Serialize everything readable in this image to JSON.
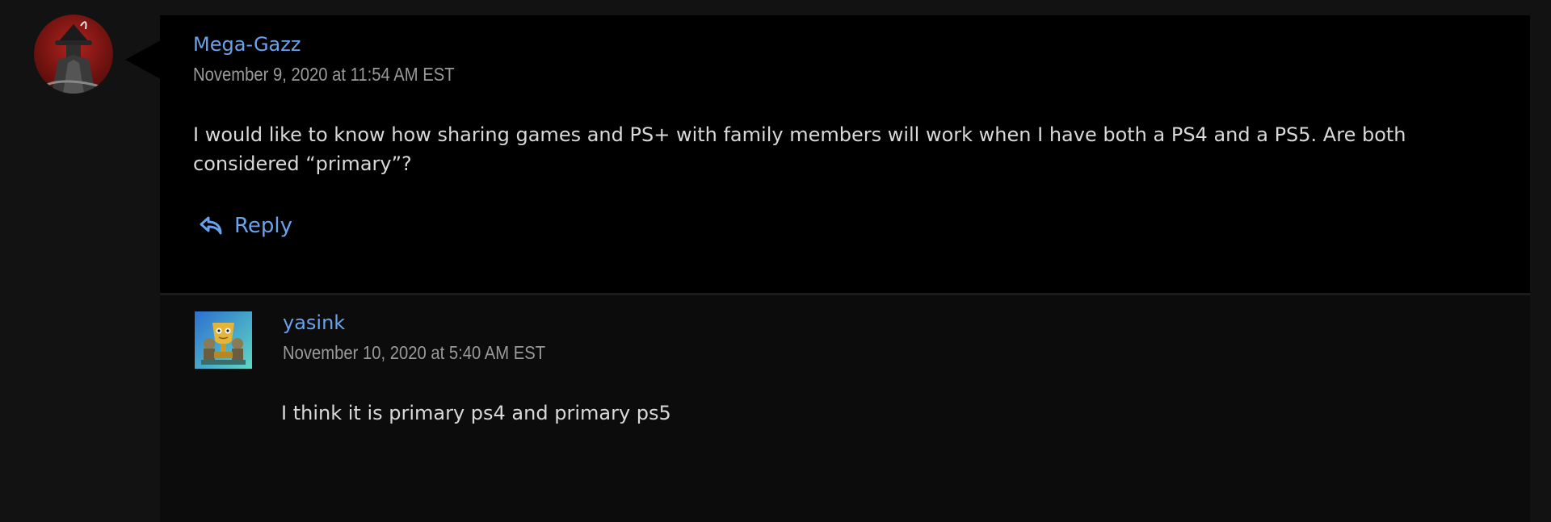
{
  "comments": [
    {
      "author": "Mega-Gazz",
      "timestamp": "November 9, 2020 at 11:54 AM EST",
      "body": "I would like to know how sharing games and PS+ with family members will work when I have both a PS4 and a PS5. Are both considered “primary”?",
      "reply_label": "Reply",
      "avatar_icon": "hunter-avatar-icon"
    },
    {
      "author": "yasink",
      "timestamp": "November 10, 2020 at 5:40 AM EST",
      "body": "I think it is primary ps4 and primary ps5",
      "avatar_icon": "trophy-avatar-icon"
    }
  ],
  "colors": {
    "link": "#6aa2ec",
    "text": "#d9d9d9",
    "meta": "#9a9a9a",
    "page_bg": "#121212",
    "comment_bg": "#000000",
    "reply_bg": "#0c0c0c"
  }
}
